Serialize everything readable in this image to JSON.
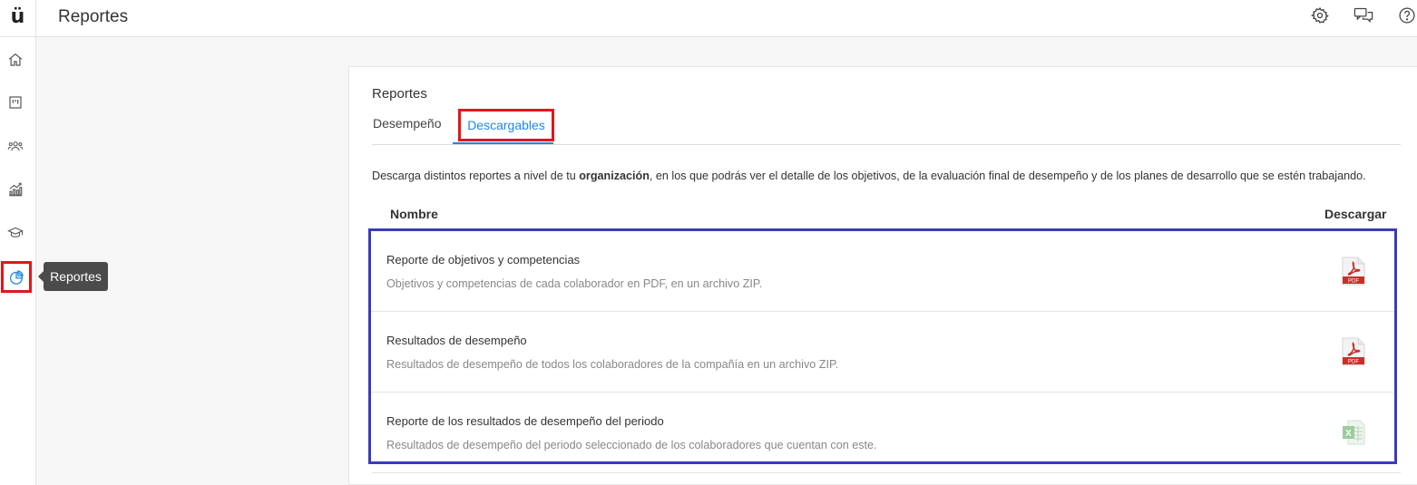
{
  "app": {
    "logo_text": "ü",
    "title": "Reportes"
  },
  "topbar_icons": [
    "gear-icon",
    "chat-icon",
    "help-icon"
  ],
  "sidebar": {
    "items": [
      {
        "name": "home-icon"
      },
      {
        "name": "board-icon"
      },
      {
        "name": "people-icon"
      },
      {
        "name": "growth-chart-icon"
      },
      {
        "name": "graduation-cap-icon"
      },
      {
        "name": "pie-chart-icon",
        "active": true
      }
    ],
    "tooltip": "Reportes"
  },
  "card": {
    "title": "Reportes",
    "tabs": [
      {
        "label": "Desempeño",
        "active": false
      },
      {
        "label": "Descargables",
        "active": true
      }
    ],
    "description": {
      "before": "Descarga distintos reportes a nivel de tu ",
      "bold": "organización",
      "after": ", en los que podrás ver el detalle de los objetivos, de la evaluación final de desempeño y de los planes de desarrollo que se estén trabajando."
    },
    "columns": {
      "name": "Nombre",
      "download": "Descargar"
    },
    "reports": [
      {
        "title": "Reporte de objetivos y competencias",
        "subtitle": "Objetivos y competencias de cada colaborador en PDF, en un archivo ZIP.",
        "file_type": "PDF"
      },
      {
        "title": "Resultados de desempeño",
        "subtitle": "Resultados de desempeño de todos los colaboradores de la compañía en un archivo ZIP.",
        "file_type": "PDF"
      },
      {
        "title": "Reporte de los resultados de desempeño del periodo",
        "subtitle": "Resultados de desempeño del periodo seleccionado de los colaboradores que cuentan con este.",
        "file_type": "X"
      }
    ]
  },
  "colors": {
    "accent_blue": "#1e88e5",
    "highlight_red": "#e3151b",
    "highlight_blue": "#3a3bbd",
    "pdf_red": "#c9302c",
    "excel_green": "#4caf50"
  }
}
